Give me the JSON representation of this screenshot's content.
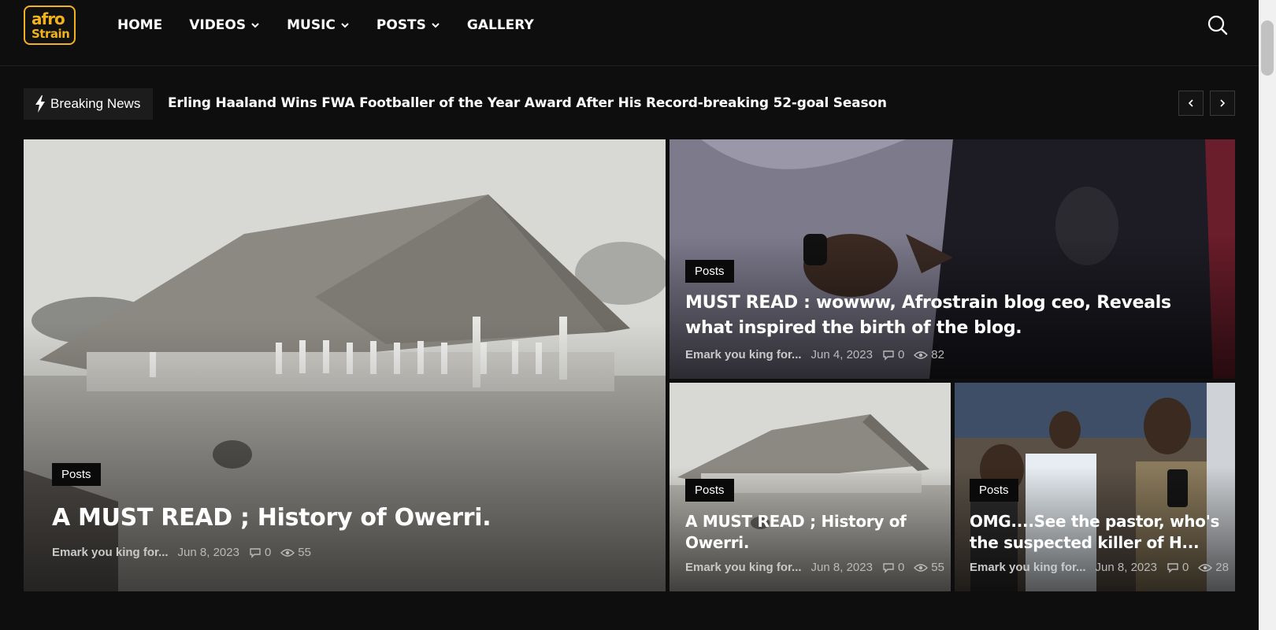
{
  "header": {
    "logo": {
      "line1": "afro",
      "line2": "Strain"
    },
    "nav": [
      {
        "label": "HOME",
        "dropdown": false
      },
      {
        "label": "VIDEOS",
        "dropdown": true
      },
      {
        "label": "MUSIC",
        "dropdown": true
      },
      {
        "label": "POSTS",
        "dropdown": true
      },
      {
        "label": "GALLERY",
        "dropdown": false
      }
    ],
    "search_icon": "search-icon"
  },
  "breaking": {
    "label": "Breaking News",
    "icon": "lightning-icon",
    "headline": "Erling Haaland Wins FWA Footballer of the Year Award After His Record-breaking 52-goal Season"
  },
  "features": {
    "main": {
      "category": "Posts",
      "title": "A MUST READ ; History of Owerri.",
      "author": "Emark you king for...",
      "date": "Jun 8, 2023",
      "comments": "0",
      "views": "55"
    },
    "top": {
      "category": "Posts",
      "title": "MUST READ : wowww, Afrostrain blog ceo, Reveals what inspired the birth of the blog.",
      "author": "Emark you king for...",
      "date": "Jun 4, 2023",
      "comments": "0",
      "views": "82"
    },
    "bottom_left": {
      "category": "Posts",
      "title": "A MUST READ ; History of Owerri.",
      "author": "Emark you king for...",
      "date": "Jun 8, 2023",
      "comments": "0",
      "views": "55"
    },
    "bottom_right": {
      "category": "Posts",
      "title": "OMG....See the pastor, who's the suspected killer of H...",
      "author": "Emark you king for...",
      "date": "Jun 8, 2023",
      "comments": "0",
      "views": "28"
    }
  },
  "colors": {
    "accent": "#f2b21c",
    "background": "#0e0e0e"
  }
}
